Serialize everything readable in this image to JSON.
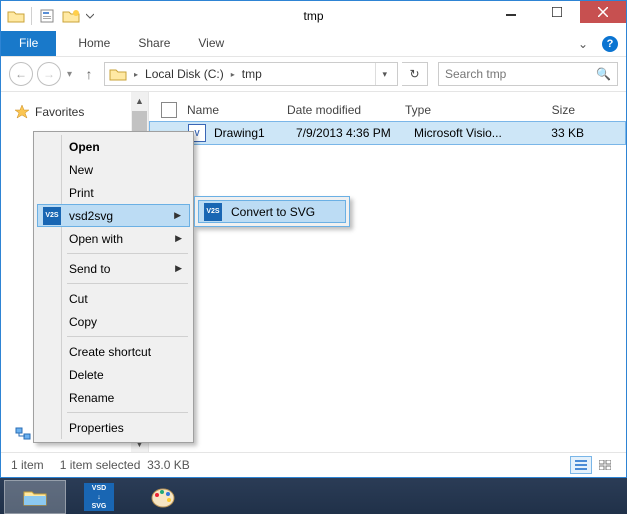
{
  "window": {
    "title": "tmp"
  },
  "ribbon": {
    "file": "File",
    "tabs": [
      "Home",
      "Share",
      "View"
    ]
  },
  "breadcrumb": {
    "parts": [
      "Local Disk (C:)",
      "tmp"
    ]
  },
  "search": {
    "placeholder": "Search tmp"
  },
  "nav": {
    "favorites": "Favorites",
    "network": "Network"
  },
  "columns": {
    "name": "Name",
    "date": "Date modified",
    "type": "Type",
    "size": "Size"
  },
  "file": {
    "name": "Drawing1",
    "date": "7/9/2013 4:36 PM",
    "type": "Microsoft Visio...",
    "size": "33 KB"
  },
  "status": {
    "count": "1 item",
    "selected": "1 item selected",
    "size": "33.0 KB"
  },
  "ctx": {
    "open": "Open",
    "new": "New",
    "print": "Print",
    "vsd2svg": "vsd2svg",
    "openwith": "Open with",
    "sendto": "Send to",
    "cut": "Cut",
    "copy": "Copy",
    "shortcut": "Create shortcut",
    "delete": "Delete",
    "rename": "Rename",
    "properties": "Properties"
  },
  "submenu": {
    "convert": "Convert to SVG"
  },
  "icons": {
    "v2s": "V2S",
    "vsdsvg": "VSD\n↓\nSVG"
  }
}
